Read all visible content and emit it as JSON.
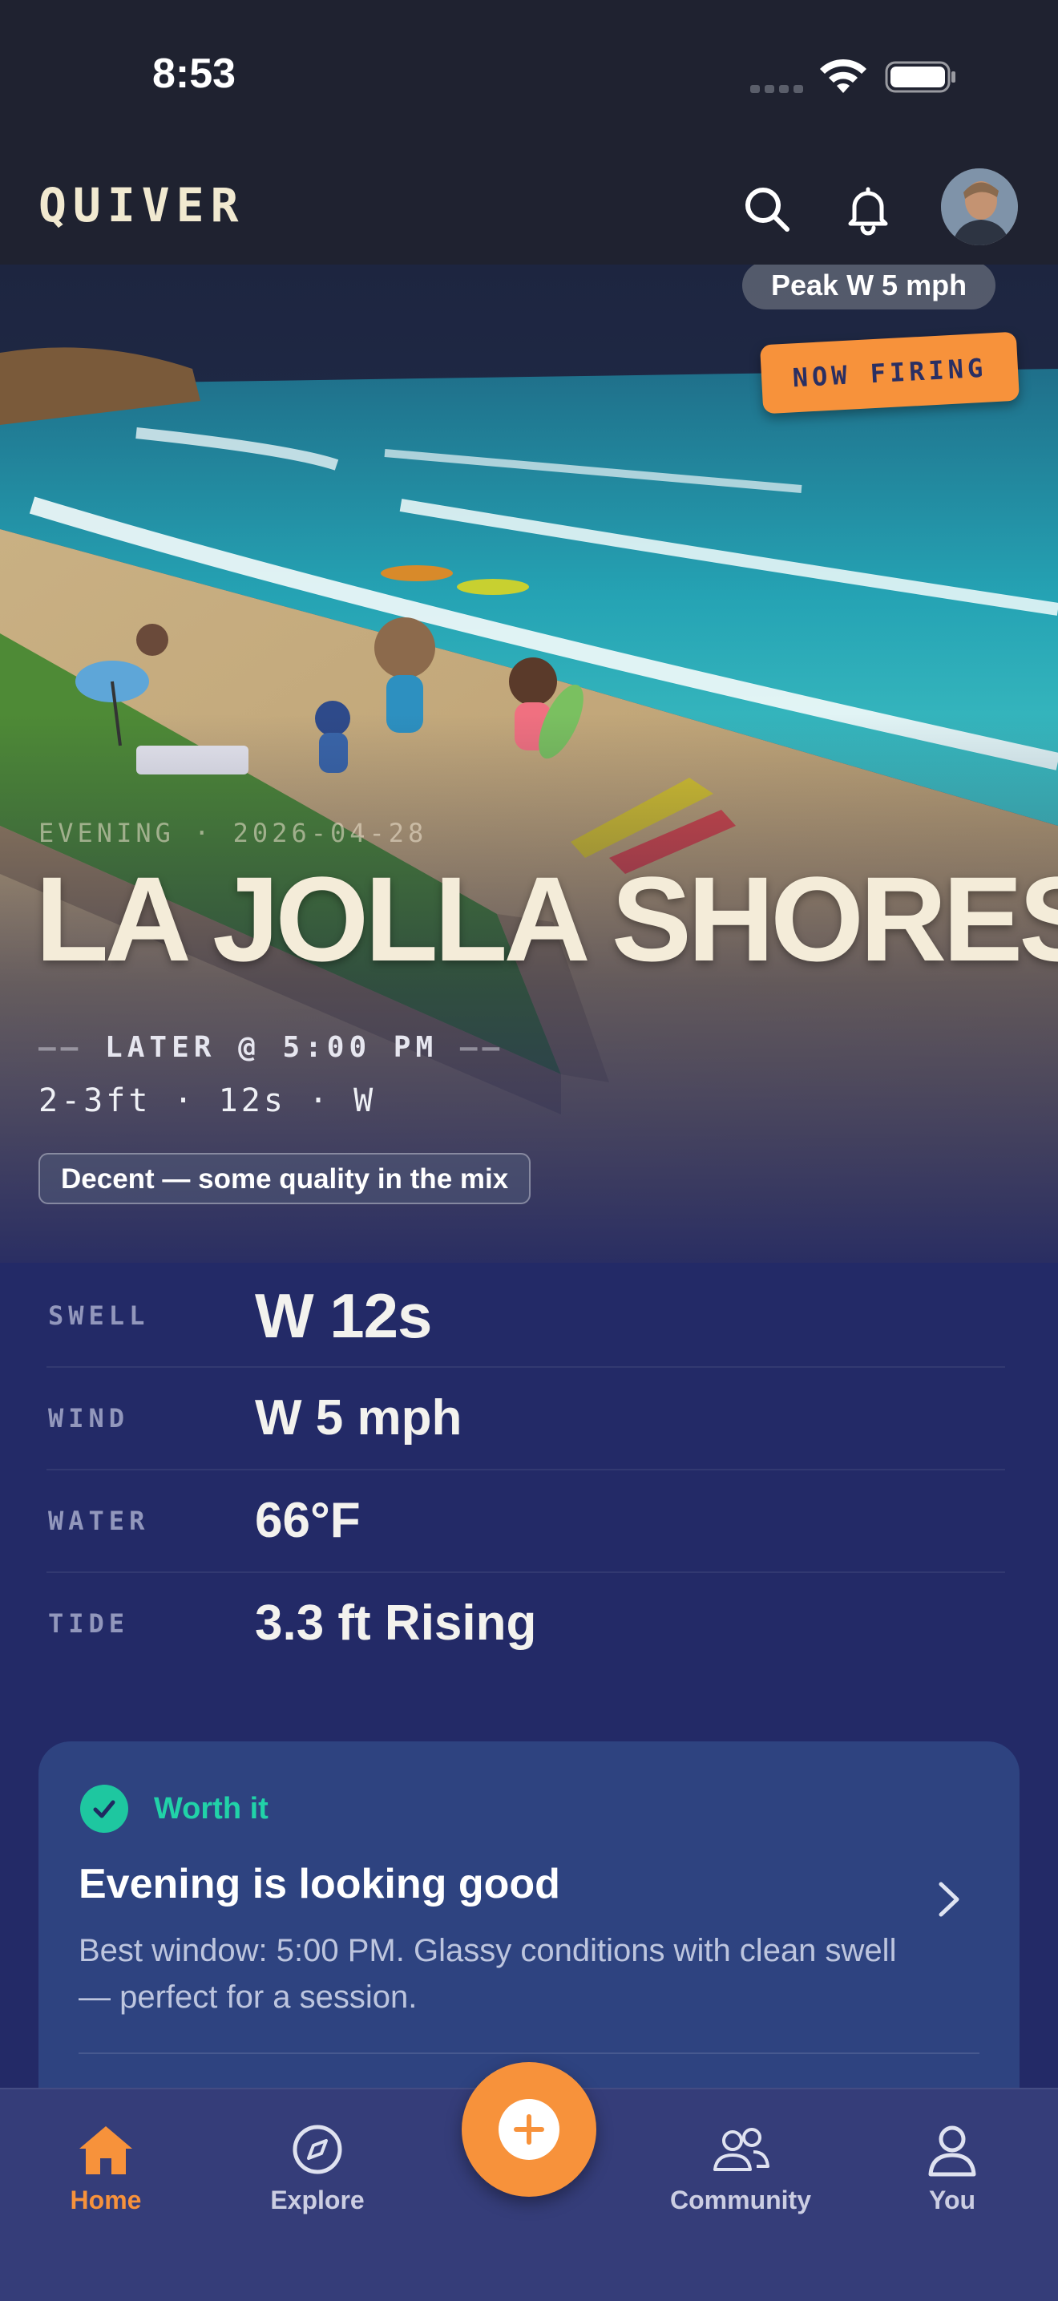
{
  "status_bar": {
    "time": "8:53"
  },
  "app_bar": {
    "brand": "QUIVER",
    "icons": [
      "search-icon",
      "bell-icon"
    ],
    "avatar": "profile-avatar"
  },
  "hero": {
    "peak_wind": "Peak W 5 mph",
    "badge": "NOW FIRING",
    "eyebrow": "EVENING · 2026-04-28",
    "spot_name": "LA JOLLA SHORES",
    "later_prefix": "——",
    "later_text": "LATER @ 5:00 PM",
    "later_suffix": "——",
    "summary": "2-3ft · 12s · W",
    "quality": "Decent — some quality in the mix"
  },
  "conditions": [
    {
      "label": "SWELL",
      "value": "W 12s"
    },
    {
      "label": "WIND",
      "value": "W 5 mph"
    },
    {
      "label": "WATER",
      "value": "66°F"
    },
    {
      "label": "TIDE",
      "value": "3.3 ft Rising"
    }
  ],
  "verdict_card": {
    "verdict": "Worth it",
    "title": "Evening is looking good",
    "body": "Best window: 5:00 PM. Glassy conditions with clean swell — perfect for a session."
  },
  "tab_bar": {
    "tabs": [
      {
        "label": "Home",
        "icon": "home-icon",
        "active": true
      },
      {
        "label": "Explore",
        "icon": "compass-icon",
        "active": false
      },
      {
        "label": "Community",
        "icon": "people-icon",
        "active": false
      },
      {
        "label": "You",
        "icon": "person-icon",
        "active": false
      }
    ],
    "fab_icon": "plus-icon"
  },
  "colors": {
    "accent": "#f7923b",
    "background": "#232a67",
    "card": "#2e4380",
    "verdict_green": "#21d2a8",
    "title_cream": "#f4ecd9"
  }
}
